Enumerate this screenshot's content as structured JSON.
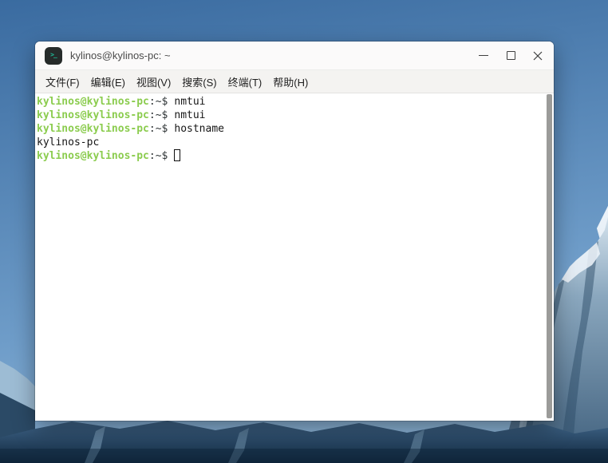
{
  "colors": {
    "prompt_green": "#8bcc4e",
    "prompt_dark": "#2e3436",
    "text": "#161616",
    "titlebar_bg": "#fbfafa",
    "menubar_bg": "#f4f3f1",
    "terminal_bg": "#ffffff",
    "scrollbar": "#9b9b99",
    "sky_top": "#3a6ba0",
    "sky_bottom": "#8ab2d5"
  },
  "icons": {
    "app": "terminal-icon",
    "minimize": "minimize-icon",
    "maximize": "maximize-icon",
    "close": "close-icon"
  },
  "window": {
    "title": "kylinos@kylinos-pc: ~",
    "icon_glyph": ">_"
  },
  "menubar": {
    "items": [
      {
        "label": "文件(F)"
      },
      {
        "label": "编辑(E)"
      },
      {
        "label": "视图(V)"
      },
      {
        "label": "搜索(S)"
      },
      {
        "label": "终端(T)"
      },
      {
        "label": "帮助(H)"
      }
    ]
  },
  "terminal": {
    "lines": [
      {
        "user": "kylinos@kylinos-pc",
        "sep": ":~$",
        "command": "nmtui"
      },
      {
        "user": "kylinos@kylinos-pc",
        "sep": ":~$",
        "command": "nmtui"
      },
      {
        "user": "kylinos@kylinos-pc",
        "sep": ":~$",
        "command": "hostname"
      },
      {
        "output": "kylinos-pc"
      },
      {
        "user": "kylinos@kylinos-pc",
        "sep": ":~$",
        "command": ""
      }
    ]
  }
}
